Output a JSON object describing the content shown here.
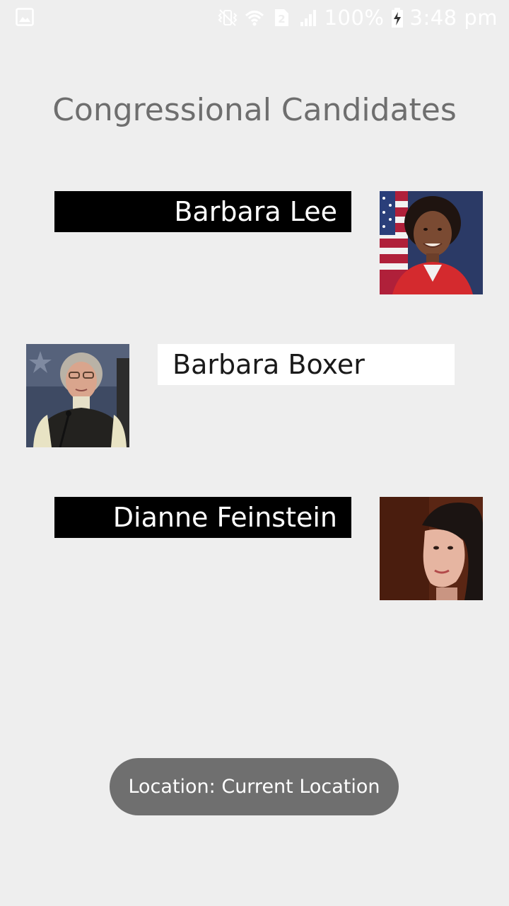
{
  "status_bar": {
    "notification_icon": "gallery-icon",
    "icons": [
      "vibrate-mute-icon",
      "wifi-icon",
      "sim-2-icon",
      "signal-icon"
    ],
    "battery_percent": "100%",
    "battery_icon": "battery-charging-icon",
    "time": "3:48 pm"
  },
  "page": {
    "title": "Congressional Candidates"
  },
  "candidates": [
    {
      "name": "Barbara Lee",
      "style": "dark",
      "photo_side": "right",
      "photo_icon": "portrait"
    },
    {
      "name": "Barbara Boxer",
      "style": "light",
      "photo_side": "left",
      "photo_icon": "portrait"
    },
    {
      "name": "Dianne Feinstein",
      "style": "dark",
      "photo_side": "right",
      "photo_icon": "portrait"
    }
  ],
  "toast": {
    "text": "Location: Current Location"
  },
  "colors": {
    "background": "#eeeeee",
    "title": "#6e6e6e",
    "dark_box": "#000000",
    "light_box": "#ffffff",
    "toast_bg": "#6f6f6f"
  }
}
